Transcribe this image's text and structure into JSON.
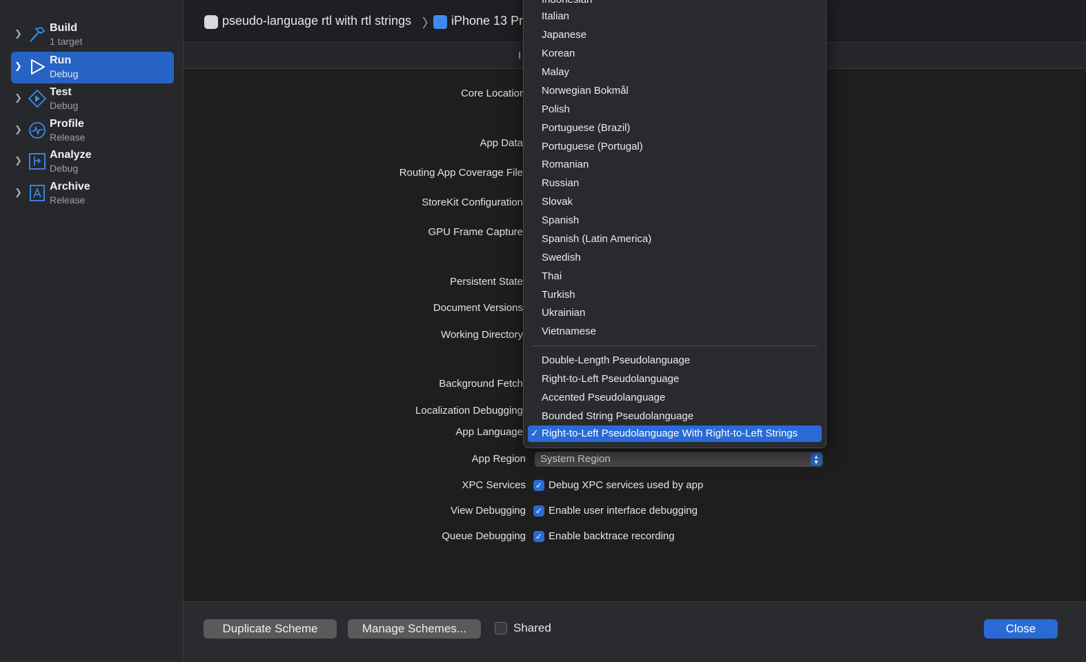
{
  "sidebar": {
    "items": [
      {
        "title": "Build",
        "subtitle": "1 target",
        "icon": "hammer-icon",
        "selected": false
      },
      {
        "title": "Run",
        "subtitle": "Debug",
        "icon": "play-icon",
        "selected": true
      },
      {
        "title": "Test",
        "subtitle": "Debug",
        "icon": "test-diamond-icon",
        "selected": false
      },
      {
        "title": "Profile",
        "subtitle": "Release",
        "icon": "gauge-icon",
        "selected": false
      },
      {
        "title": "Analyze",
        "subtitle": "Debug",
        "icon": "analyze-icon",
        "selected": false
      },
      {
        "title": "Archive",
        "subtitle": "Release",
        "icon": "archive-icon",
        "selected": false
      }
    ]
  },
  "header": {
    "scheme": "pseudo-language rtl with rtl strings",
    "separator": "〉",
    "destination": "iPhone 13 Pr"
  },
  "tabbar": {
    "visible_fragment": "I"
  },
  "form": {
    "core_location": "Core Locatior",
    "app_data": "App Data",
    "routing": "Routing App Coverage File",
    "storekit": "StoreKit Configuration",
    "gpu": "GPU Frame Capture",
    "persistent": "Persistent State",
    "doc_versions": "Document Versions",
    "working_dir": "Working Directory",
    "bg_fetch": "Background Fetch",
    "loc_debugging": "Localization Debugging",
    "app_language": "App Language",
    "app_region": "App Region",
    "app_region_value": "System Region",
    "xpc_label": "XPC Services",
    "xpc_text": "Debug XPC services used by app",
    "view_label": "View Debugging",
    "view_text": "Enable user interface debugging",
    "queue_label": "Queue Debugging",
    "queue_text": "Enable backtrace recording"
  },
  "footer": {
    "duplicate": "Duplicate Scheme",
    "manage": "Manage Schemes...",
    "shared": "Shared",
    "close": "Close"
  },
  "menu": {
    "languages": [
      "Indonesian",
      "Italian",
      "Japanese",
      "Korean",
      "Malay",
      "Norwegian Bokmål",
      "Polish",
      "Portuguese (Brazil)",
      "Portuguese (Portugal)",
      "Romanian",
      "Russian",
      "Slovak",
      "Spanish",
      "Spanish (Latin America)",
      "Swedish",
      "Thai",
      "Turkish",
      "Ukrainian",
      "Vietnamese"
    ],
    "pseudo": [
      "Double-Length Pseudolanguage",
      "Right-to-Left Pseudolanguage",
      "Accented Pseudolanguage",
      "Bounded String Pseudolanguage",
      "Right-to-Left Pseudolanguage With Right-to-Left Strings"
    ],
    "selected_index": 4,
    "check": "✓"
  },
  "colors": {
    "accent": "#2a6ad6",
    "sidebar_selected": "#2763c4",
    "background": "#1e1e1e"
  }
}
